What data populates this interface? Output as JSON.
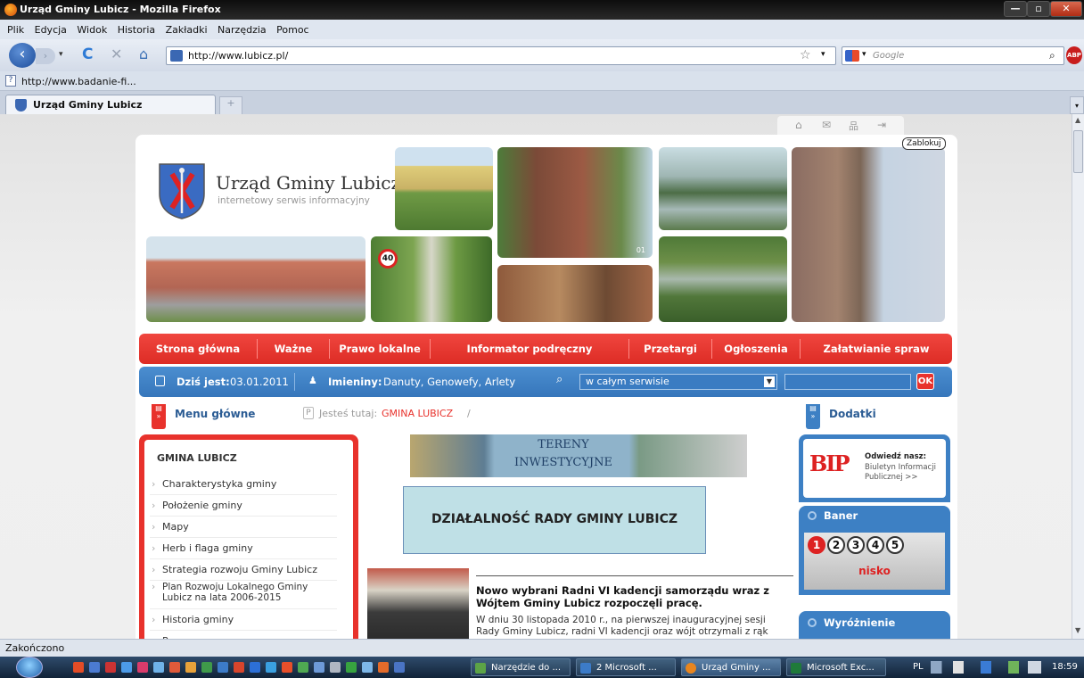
{
  "window": {
    "title": "Urząd Gminy Lubicz - Mozilla Firefox"
  },
  "menubar": [
    "Plik",
    "Edycja",
    "Widok",
    "Historia",
    "Zakładki",
    "Narzędzia",
    "Pomoc"
  ],
  "nav": {
    "url": "http://www.lubicz.pl/",
    "search_placeholder": "Google"
  },
  "bookmarks": {
    "item": "http://www.badanie-fi..."
  },
  "tab": {
    "label": "Urząd Gminy Lubicz",
    "new_tab": "+"
  },
  "site": {
    "top_icons": [
      "⌂",
      "✉",
      "品",
      "⇥"
    ],
    "zablokuj": "Zablokuj",
    "title": "Urząd Gminy Lubicz",
    "subtitle": "internetowy serwis informacyjny",
    "nav": [
      "Strona główna",
      "Ważne",
      "Prawo lokalne",
      "Informator podręczny",
      "Przetargi",
      "Ogłoszenia",
      "Załatwianie spraw"
    ],
    "info": {
      "date_label": "Dziś jest:",
      "date": "03.01.2011",
      "names_label": "Imieniny:",
      "names": "Danuty, Genowefy, Arlety",
      "search_scope": "w całym serwisie",
      "ok": "OK"
    },
    "menu_title": "Menu główne",
    "breadcrumb_label": "Jesteś tutaj:",
    "breadcrumb_item": "GMINA LUBICZ",
    "breadcrumb_sep": "/",
    "extras_title": "Dodatki",
    "left_menu_head": "GMINA LUBICZ",
    "left_menu": [
      "Charakterystyka gminy",
      "Położenie gminy",
      "Mapy",
      "Herb i flaga gminy",
      "Strategia rozwoju Gminy Lubicz",
      "Plan Rozwoju Lokalnego Gminy Lubicz na lata 2006-2015",
      "Historia gminy",
      "Programy"
    ],
    "banner_tereny": "TERENY INWESTYCYJNE",
    "banner_rada": "DZIAŁALNOŚĆ RADY GMINY LUBICZ",
    "news_title": "Nowo wybrani Radni VI kadencji samorządu wraz z Wójtem Gminy Lubicz rozpoczęli pracę.",
    "news_text": "W dniu 30 listopada 2010 r., na pierwszej inauguracyjnej sesji Rady Gminy Lubicz, radni VI kadencji oraz wójt otrzymali z rąk",
    "bip_label": "BIP",
    "bip_visit": "Odwiedź nasz:",
    "bip_text": "Biuletyn Informacji Publicznej >>",
    "baner_title": "Baner",
    "baner_nums": [
      "1",
      "2",
      "3",
      "4",
      "5"
    ],
    "baner_text": "nisko",
    "wyroznienie": "Wyróżnienie",
    "photo_label": "01"
  },
  "status": "Zakończono",
  "taskbar": {
    "items": [
      "Narzędzie do ...",
      "2 Microsoft ...",
      "Urząd Gminy ...",
      "Microsoft Exc..."
    ],
    "lang": "PL",
    "time": "18:59"
  },
  "colors": {
    "red": "#e8322c",
    "blue": "#3d80c4"
  }
}
